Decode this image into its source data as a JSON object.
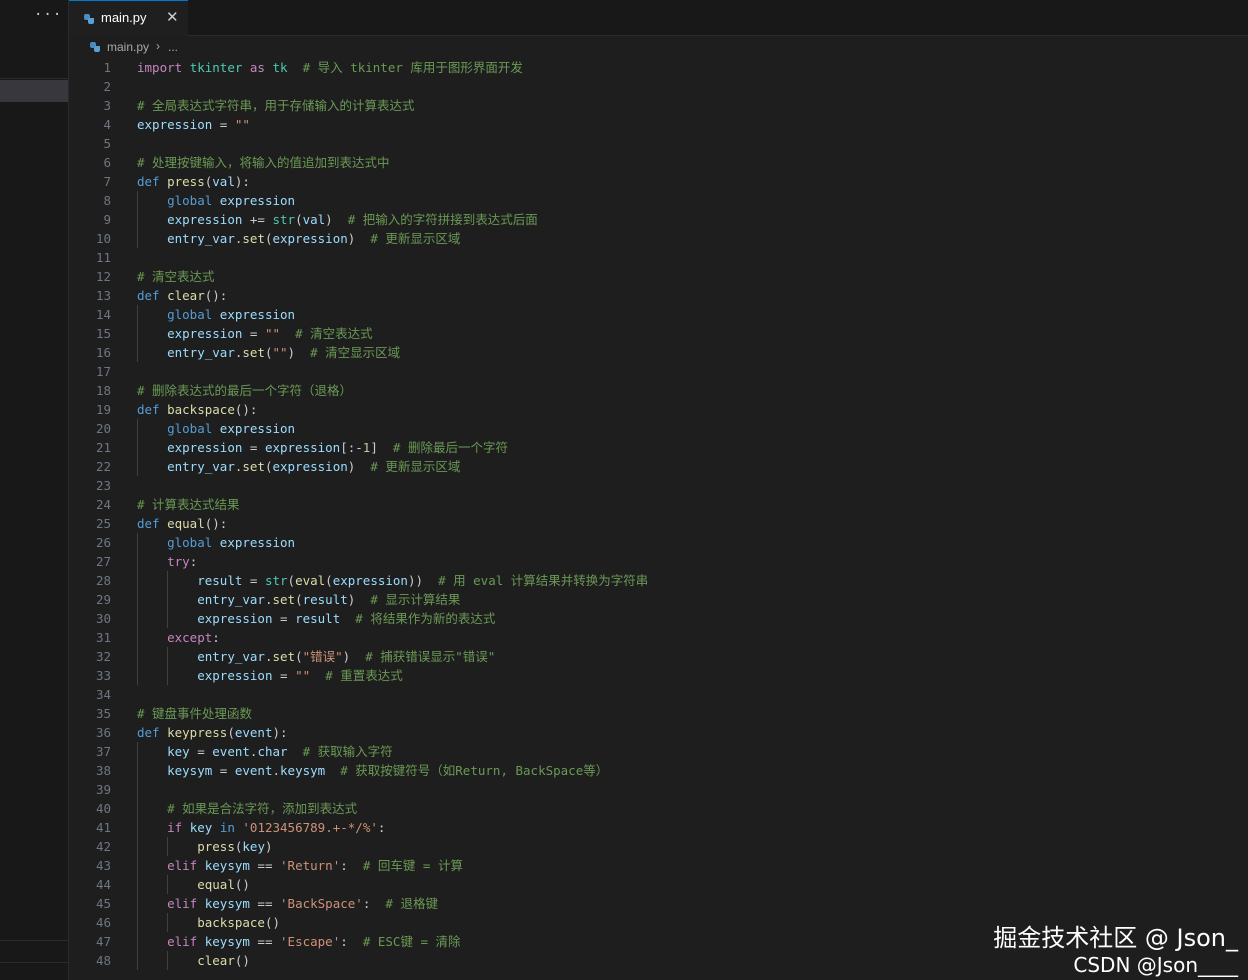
{
  "sidebar": {
    "more_label": "···"
  },
  "tab": {
    "label": "main.py",
    "close": "✕"
  },
  "breadcrumb": {
    "file": "main.py",
    "separator": "›",
    "rest": "..."
  },
  "colors": {
    "keyword": "#c586c0",
    "storage": "#569cd6",
    "function": "#dcdcaa",
    "variable": "#9cdcfe",
    "string": "#ce9178",
    "comment": "#6a9955",
    "number": "#b5cea8",
    "builtin": "#4ec9b0",
    "plain": "#cccccc",
    "line_number": "#6e7681"
  },
  "editor": {
    "lines": [
      [
        [
          "kw",
          "import"
        ],
        [
          "p",
          " "
        ],
        [
          "cls",
          "tkinter"
        ],
        [
          "p",
          " "
        ],
        [
          "kw",
          "as"
        ],
        [
          "p",
          " "
        ],
        [
          "cls",
          "tk"
        ],
        [
          "p",
          "  "
        ],
        [
          "cm",
          "# 导入 tkinter 库用于图形界面开发"
        ]
      ],
      [],
      [
        [
          "cm",
          "# 全局表达式字符串，用于存储输入的计算表达式"
        ]
      ],
      [
        [
          "var",
          "expression"
        ],
        [
          "p",
          " = "
        ],
        [
          "str",
          "\"\""
        ]
      ],
      [],
      [
        [
          "cm",
          "# 处理按键输入，将输入的值追加到表达式中"
        ]
      ],
      [
        [
          "st",
          "def"
        ],
        [
          "p",
          " "
        ],
        [
          "fn",
          "press"
        ],
        [
          "p",
          "("
        ],
        [
          "var",
          "val"
        ],
        [
          "p",
          "):"
        ]
      ],
      [
        [
          "p",
          "    "
        ],
        [
          "st",
          "global"
        ],
        [
          "p",
          " "
        ],
        [
          "var",
          "expression"
        ]
      ],
      [
        [
          "p",
          "    "
        ],
        [
          "var",
          "expression"
        ],
        [
          "p",
          " += "
        ],
        [
          "bi",
          "str"
        ],
        [
          "p",
          "("
        ],
        [
          "var",
          "val"
        ],
        [
          "p",
          ")  "
        ],
        [
          "cm",
          "# 把输入的字符拼接到表达式后面"
        ]
      ],
      [
        [
          "p",
          "    "
        ],
        [
          "var",
          "entry_var"
        ],
        [
          "p",
          "."
        ],
        [
          "fn",
          "set"
        ],
        [
          "p",
          "("
        ],
        [
          "var",
          "expression"
        ],
        [
          "p",
          ")  "
        ],
        [
          "cm",
          "# 更新显示区域"
        ]
      ],
      [],
      [
        [
          "cm",
          "# 清空表达式"
        ]
      ],
      [
        [
          "st",
          "def"
        ],
        [
          "p",
          " "
        ],
        [
          "fn",
          "clear"
        ],
        [
          "p",
          "():"
        ]
      ],
      [
        [
          "p",
          "    "
        ],
        [
          "st",
          "global"
        ],
        [
          "p",
          " "
        ],
        [
          "var",
          "expression"
        ]
      ],
      [
        [
          "p",
          "    "
        ],
        [
          "var",
          "expression"
        ],
        [
          "p",
          " = "
        ],
        [
          "str",
          "\"\""
        ],
        [
          "p",
          "  "
        ],
        [
          "cm",
          "# 清空表达式"
        ]
      ],
      [
        [
          "p",
          "    "
        ],
        [
          "var",
          "entry_var"
        ],
        [
          "p",
          "."
        ],
        [
          "fn",
          "set"
        ],
        [
          "p",
          "("
        ],
        [
          "str",
          "\"\""
        ],
        [
          "p",
          ")  "
        ],
        [
          "cm",
          "# 清空显示区域"
        ]
      ],
      [],
      [
        [
          "cm",
          "# 删除表达式的最后一个字符（退格）"
        ]
      ],
      [
        [
          "st",
          "def"
        ],
        [
          "p",
          " "
        ],
        [
          "fn",
          "backspace"
        ],
        [
          "p",
          "():"
        ]
      ],
      [
        [
          "p",
          "    "
        ],
        [
          "st",
          "global"
        ],
        [
          "p",
          " "
        ],
        [
          "var",
          "expression"
        ]
      ],
      [
        [
          "p",
          "    "
        ],
        [
          "var",
          "expression"
        ],
        [
          "p",
          " = "
        ],
        [
          "var",
          "expression"
        ],
        [
          "p",
          "[:-"
        ],
        [
          "num",
          "1"
        ],
        [
          "p",
          "]  "
        ],
        [
          "cm",
          "# 删除最后一个字符"
        ]
      ],
      [
        [
          "p",
          "    "
        ],
        [
          "var",
          "entry_var"
        ],
        [
          "p",
          "."
        ],
        [
          "fn",
          "set"
        ],
        [
          "p",
          "("
        ],
        [
          "var",
          "expression"
        ],
        [
          "p",
          ")  "
        ],
        [
          "cm",
          "# 更新显示区域"
        ]
      ],
      [],
      [
        [
          "cm",
          "# 计算表达式结果"
        ]
      ],
      [
        [
          "st",
          "def"
        ],
        [
          "p",
          " "
        ],
        [
          "fn",
          "equal"
        ],
        [
          "p",
          "():"
        ]
      ],
      [
        [
          "p",
          "    "
        ],
        [
          "st",
          "global"
        ],
        [
          "p",
          " "
        ],
        [
          "var",
          "expression"
        ]
      ],
      [
        [
          "p",
          "    "
        ],
        [
          "kw",
          "try"
        ],
        [
          "p",
          ":"
        ]
      ],
      [
        [
          "p",
          "        "
        ],
        [
          "var",
          "result"
        ],
        [
          "p",
          " = "
        ],
        [
          "bi",
          "str"
        ],
        [
          "p",
          "("
        ],
        [
          "fn",
          "eval"
        ],
        [
          "p",
          "("
        ],
        [
          "var",
          "expression"
        ],
        [
          "p",
          "))  "
        ],
        [
          "cm",
          "# 用 eval 计算结果并转换为字符串"
        ]
      ],
      [
        [
          "p",
          "        "
        ],
        [
          "var",
          "entry_var"
        ],
        [
          "p",
          "."
        ],
        [
          "fn",
          "set"
        ],
        [
          "p",
          "("
        ],
        [
          "var",
          "result"
        ],
        [
          "p",
          ")  "
        ],
        [
          "cm",
          "# 显示计算结果"
        ]
      ],
      [
        [
          "p",
          "        "
        ],
        [
          "var",
          "expression"
        ],
        [
          "p",
          " = "
        ],
        [
          "var",
          "result"
        ],
        [
          "p",
          "  "
        ],
        [
          "cm",
          "# 将结果作为新的表达式"
        ]
      ],
      [
        [
          "p",
          "    "
        ],
        [
          "kw",
          "except"
        ],
        [
          "p",
          ":"
        ]
      ],
      [
        [
          "p",
          "        "
        ],
        [
          "var",
          "entry_var"
        ],
        [
          "p",
          "."
        ],
        [
          "fn",
          "set"
        ],
        [
          "p",
          "("
        ],
        [
          "str",
          "\"错误\""
        ],
        [
          "p",
          ")  "
        ],
        [
          "cm",
          "# 捕获错误显示\"错误\""
        ]
      ],
      [
        [
          "p",
          "        "
        ],
        [
          "var",
          "expression"
        ],
        [
          "p",
          " = "
        ],
        [
          "str",
          "\"\""
        ],
        [
          "p",
          "  "
        ],
        [
          "cm",
          "# 重置表达式"
        ]
      ],
      [],
      [
        [
          "cm",
          "# 键盘事件处理函数"
        ]
      ],
      [
        [
          "st",
          "def"
        ],
        [
          "p",
          " "
        ],
        [
          "fn",
          "keypress"
        ],
        [
          "p",
          "("
        ],
        [
          "var",
          "event"
        ],
        [
          "p",
          "):"
        ]
      ],
      [
        [
          "p",
          "    "
        ],
        [
          "var",
          "key"
        ],
        [
          "p",
          " = "
        ],
        [
          "var",
          "event"
        ],
        [
          "p",
          "."
        ],
        [
          "var",
          "char"
        ],
        [
          "p",
          "  "
        ],
        [
          "cm",
          "# 获取输入字符"
        ]
      ],
      [
        [
          "p",
          "    "
        ],
        [
          "var",
          "keysym"
        ],
        [
          "p",
          " = "
        ],
        [
          "var",
          "event"
        ],
        [
          "p",
          "."
        ],
        [
          "var",
          "keysym"
        ],
        [
          "p",
          "  "
        ],
        [
          "cm",
          "# 获取按键符号（如Return, BackSpace等）"
        ]
      ],
      [],
      [
        [
          "p",
          "    "
        ],
        [
          "cm",
          "# 如果是合法字符，添加到表达式"
        ]
      ],
      [
        [
          "p",
          "    "
        ],
        [
          "kw",
          "if"
        ],
        [
          "p",
          " "
        ],
        [
          "var",
          "key"
        ],
        [
          "p",
          " "
        ],
        [
          "st",
          "in"
        ],
        [
          "p",
          " "
        ],
        [
          "str",
          "'0123456789.+-*/%'"
        ],
        [
          "p",
          ":"
        ]
      ],
      [
        [
          "p",
          "        "
        ],
        [
          "fn",
          "press"
        ],
        [
          "p",
          "("
        ],
        [
          "var",
          "key"
        ],
        [
          "p",
          ")"
        ]
      ],
      [
        [
          "p",
          "    "
        ],
        [
          "kw",
          "elif"
        ],
        [
          "p",
          " "
        ],
        [
          "var",
          "keysym"
        ],
        [
          "p",
          " == "
        ],
        [
          "str",
          "'Return'"
        ],
        [
          "p",
          ":  "
        ],
        [
          "cm",
          "# 回车键 = 计算"
        ]
      ],
      [
        [
          "p",
          "        "
        ],
        [
          "fn",
          "equal"
        ],
        [
          "p",
          "()"
        ]
      ],
      [
        [
          "p",
          "    "
        ],
        [
          "kw",
          "elif"
        ],
        [
          "p",
          " "
        ],
        [
          "var",
          "keysym"
        ],
        [
          "p",
          " == "
        ],
        [
          "str",
          "'BackSpace'"
        ],
        [
          "p",
          ":  "
        ],
        [
          "cm",
          "# 退格键"
        ]
      ],
      [
        [
          "p",
          "        "
        ],
        [
          "fn",
          "backspace"
        ],
        [
          "p",
          "()"
        ]
      ],
      [
        [
          "p",
          "    "
        ],
        [
          "kw",
          "elif"
        ],
        [
          "p",
          " "
        ],
        [
          "var",
          "keysym"
        ],
        [
          "p",
          " == "
        ],
        [
          "str",
          "'Escape'"
        ],
        [
          "p",
          ":  "
        ],
        [
          "cm",
          "# ESC键 = 清除"
        ]
      ],
      [
        [
          "p",
          "        "
        ],
        [
          "fn",
          "clear"
        ],
        [
          "p",
          "()"
        ]
      ]
    ]
  },
  "watermark": {
    "line1": "掘金技术社区 @ Json_",
    "line2": "CSDN @Json____"
  }
}
